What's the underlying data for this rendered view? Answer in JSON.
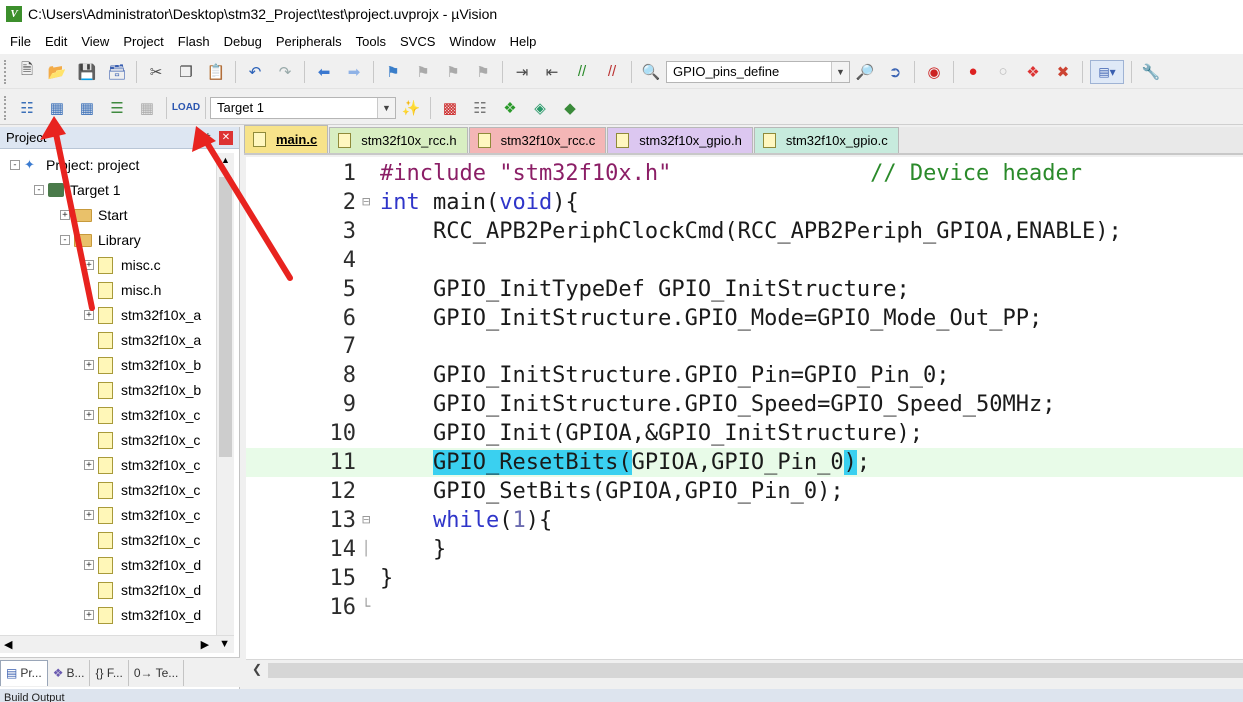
{
  "window": {
    "title": "C:\\Users\\Administrator\\Desktop\\stm32_Project\\test\\project.uvprojx - µVision"
  },
  "menu": [
    "File",
    "Edit",
    "View",
    "Project",
    "Flash",
    "Debug",
    "Peripherals",
    "Tools",
    "SVCS",
    "Window",
    "Help"
  ],
  "toolbar1": {
    "combo_value": "GPIO_pins_define"
  },
  "toolbar2": {
    "target_value": "Target 1"
  },
  "project_panel": {
    "title": "Project",
    "tree": [
      {
        "label": "Project: project",
        "level": 0,
        "expander": "-",
        "icon": "project-icon"
      },
      {
        "label": "Target 1",
        "level": 1,
        "expander": "-",
        "icon": "target-icon"
      },
      {
        "label": "Start",
        "level": 2,
        "expander": "+",
        "icon": "folder-icon"
      },
      {
        "label": "Library",
        "level": 2,
        "expander": "-",
        "icon": "folder-icon"
      },
      {
        "label": "misc.c",
        "level": 3,
        "expander": "+",
        "icon": "file-icon"
      },
      {
        "label": "misc.h",
        "level": 3,
        "expander": "",
        "icon": "file-icon"
      },
      {
        "label": "stm32f10x_a",
        "level": 3,
        "expander": "+",
        "icon": "file-icon"
      },
      {
        "label": "stm32f10x_a",
        "level": 3,
        "expander": "",
        "icon": "file-icon"
      },
      {
        "label": "stm32f10x_b",
        "level": 3,
        "expander": "+",
        "icon": "file-icon"
      },
      {
        "label": "stm32f10x_b",
        "level": 3,
        "expander": "",
        "icon": "file-icon"
      },
      {
        "label": "stm32f10x_c",
        "level": 3,
        "expander": "+",
        "icon": "file-icon"
      },
      {
        "label": "stm32f10x_c",
        "level": 3,
        "expander": "",
        "icon": "file-icon"
      },
      {
        "label": "stm32f10x_c",
        "level": 3,
        "expander": "+",
        "icon": "file-icon"
      },
      {
        "label": "stm32f10x_c",
        "level": 3,
        "expander": "",
        "icon": "file-icon"
      },
      {
        "label": "stm32f10x_c",
        "level": 3,
        "expander": "+",
        "icon": "file-icon"
      },
      {
        "label": "stm32f10x_c",
        "level": 3,
        "expander": "",
        "icon": "file-icon"
      },
      {
        "label": "stm32f10x_d",
        "level": 3,
        "expander": "+",
        "icon": "file-icon"
      },
      {
        "label": "stm32f10x_d",
        "level": 3,
        "expander": "",
        "icon": "file-icon"
      },
      {
        "label": "stm32f10x_d",
        "level": 3,
        "expander": "+",
        "icon": "file-icon"
      }
    ],
    "tabs": [
      "Pr...",
      "B...",
      "{} F...",
      "0→ Te..."
    ]
  },
  "editor_tabs": [
    {
      "label": "main.c",
      "active": true,
      "color": "#f7e38a"
    },
    {
      "label": "stm32f10x_rcc.h",
      "active": false,
      "color": "#d8eec2"
    },
    {
      "label": "stm32f10x_rcc.c",
      "active": false,
      "color": "#f4b6b6"
    },
    {
      "label": "stm32f10x_gpio.h",
      "active": false,
      "color": "#dcc7f0"
    },
    {
      "label": "stm32f10x_gpio.c",
      "active": false,
      "color": "#c7ebdd"
    }
  ],
  "code": {
    "lines": [
      {
        "n": "1",
        "fold": "",
        "html": "<span class='str'>#include \"stm32f10x.h\"</span>               <span class='cm'>// Device header</span>"
      },
      {
        "n": "2",
        "fold": "⊟",
        "html": "<span class='kw'>int</span> main(<span class='kw'>void</span>){"
      },
      {
        "n": "3",
        "fold": "",
        "html": "    RCC_APB2PeriphClockCmd(RCC_APB2Periph_GPIOA,ENABLE);"
      },
      {
        "n": "4",
        "fold": "",
        "html": ""
      },
      {
        "n": "5",
        "fold": "",
        "html": "    GPIO_InitTypeDef GPIO_InitStructure;"
      },
      {
        "n": "6",
        "fold": "",
        "html": "    GPIO_InitStructure.GPIO_Mode=GPIO_Mode_Out_PP;"
      },
      {
        "n": "7",
        "fold": "",
        "html": ""
      },
      {
        "n": "8",
        "fold": "",
        "html": "    GPIO_InitStructure.GPIO_Pin=GPIO_Pin_0;"
      },
      {
        "n": "9",
        "fold": "",
        "html": "    GPIO_InitStructure.GPIO_Speed=GPIO_Speed_50MHz;"
      },
      {
        "n": "10",
        "fold": "",
        "html": "    GPIO_Init(GPIOA,&GPIO_InitStructure);"
      },
      {
        "n": "11",
        "fold": "",
        "html": "    <span class='sel'>GPIO_ResetBits(</span>GPIOA,GPIO_Pin_0<span class='sel'>)</span>;",
        "highlight": true
      },
      {
        "n": "12",
        "fold": "",
        "html": "    GPIO_SetBits(GPIOA,GPIO_Pin_0);"
      },
      {
        "n": "13",
        "fold": "⊟",
        "html": "    <span class='kw'>while</span>(<span class='num'>1</span>){"
      },
      {
        "n": "14",
        "fold": "│",
        "html": "    }"
      },
      {
        "n": "15",
        "fold": "",
        "html": "}"
      },
      {
        "n": "16",
        "fold": "└",
        "html": ""
      }
    ]
  },
  "status": {
    "text": "Build Output"
  },
  "colors": {
    "arrow": "#e8231f",
    "line_highlight": "#e8fbe8",
    "selection": "#3ad0f0"
  }
}
